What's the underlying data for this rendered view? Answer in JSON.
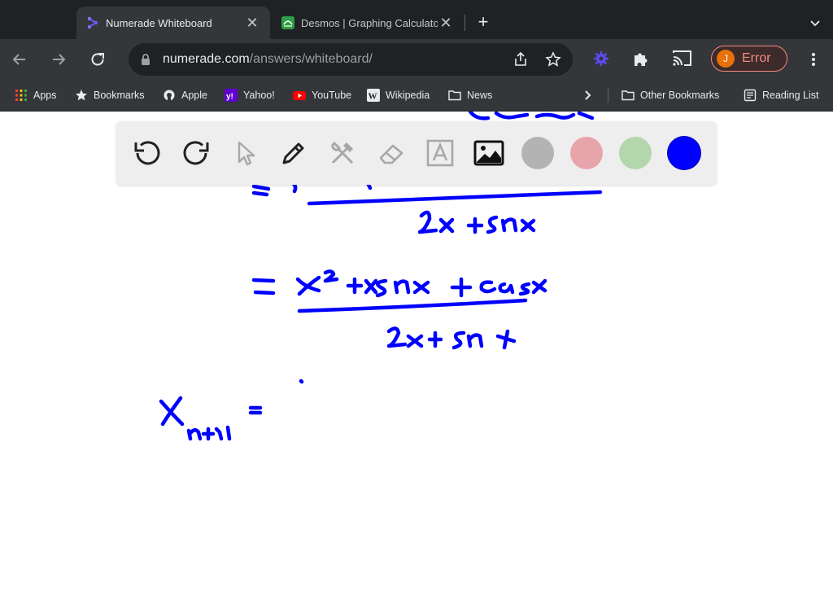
{
  "tabs": [
    {
      "title": "Numerade Whiteboard",
      "active": true,
      "icon": "numerade-logo-icon"
    },
    {
      "title": "Desmos | Graphing Calculator",
      "active": false,
      "icon": "desmos-logo-icon"
    }
  ],
  "address_bar": {
    "domain": "numerade.com",
    "path": "/answers/whiteboard/"
  },
  "profile": {
    "initial": "J",
    "status": "Error"
  },
  "bookmarks": [
    {
      "label": "Apps",
      "icon": "apps-grid-icon"
    },
    {
      "label": "Bookmarks",
      "icon": "star-icon"
    },
    {
      "label": "Apple",
      "icon": "apple-icon"
    },
    {
      "label": "Yahoo!",
      "icon": "yahoo-icon"
    },
    {
      "label": "YouTube",
      "icon": "youtube-icon"
    },
    {
      "label": "Wikipedia",
      "icon": "wikipedia-icon"
    },
    {
      "label": "News",
      "icon": "folder-icon"
    }
  ],
  "bookmarks_right": [
    {
      "label": "Other Bookmarks",
      "icon": "folder-icon"
    },
    {
      "label": "Reading List",
      "icon": "reading-list-icon"
    }
  ],
  "whiteboard": {
    "tools": [
      "undo",
      "redo",
      "select",
      "pen",
      "tools",
      "eraser",
      "text",
      "image"
    ],
    "colors": [
      "#b3b3b3",
      "#e8a4ab",
      "#b3d6ad",
      "#0000ff"
    ],
    "selected_color": "#0000ff",
    "ink_color": "#0000ff"
  }
}
